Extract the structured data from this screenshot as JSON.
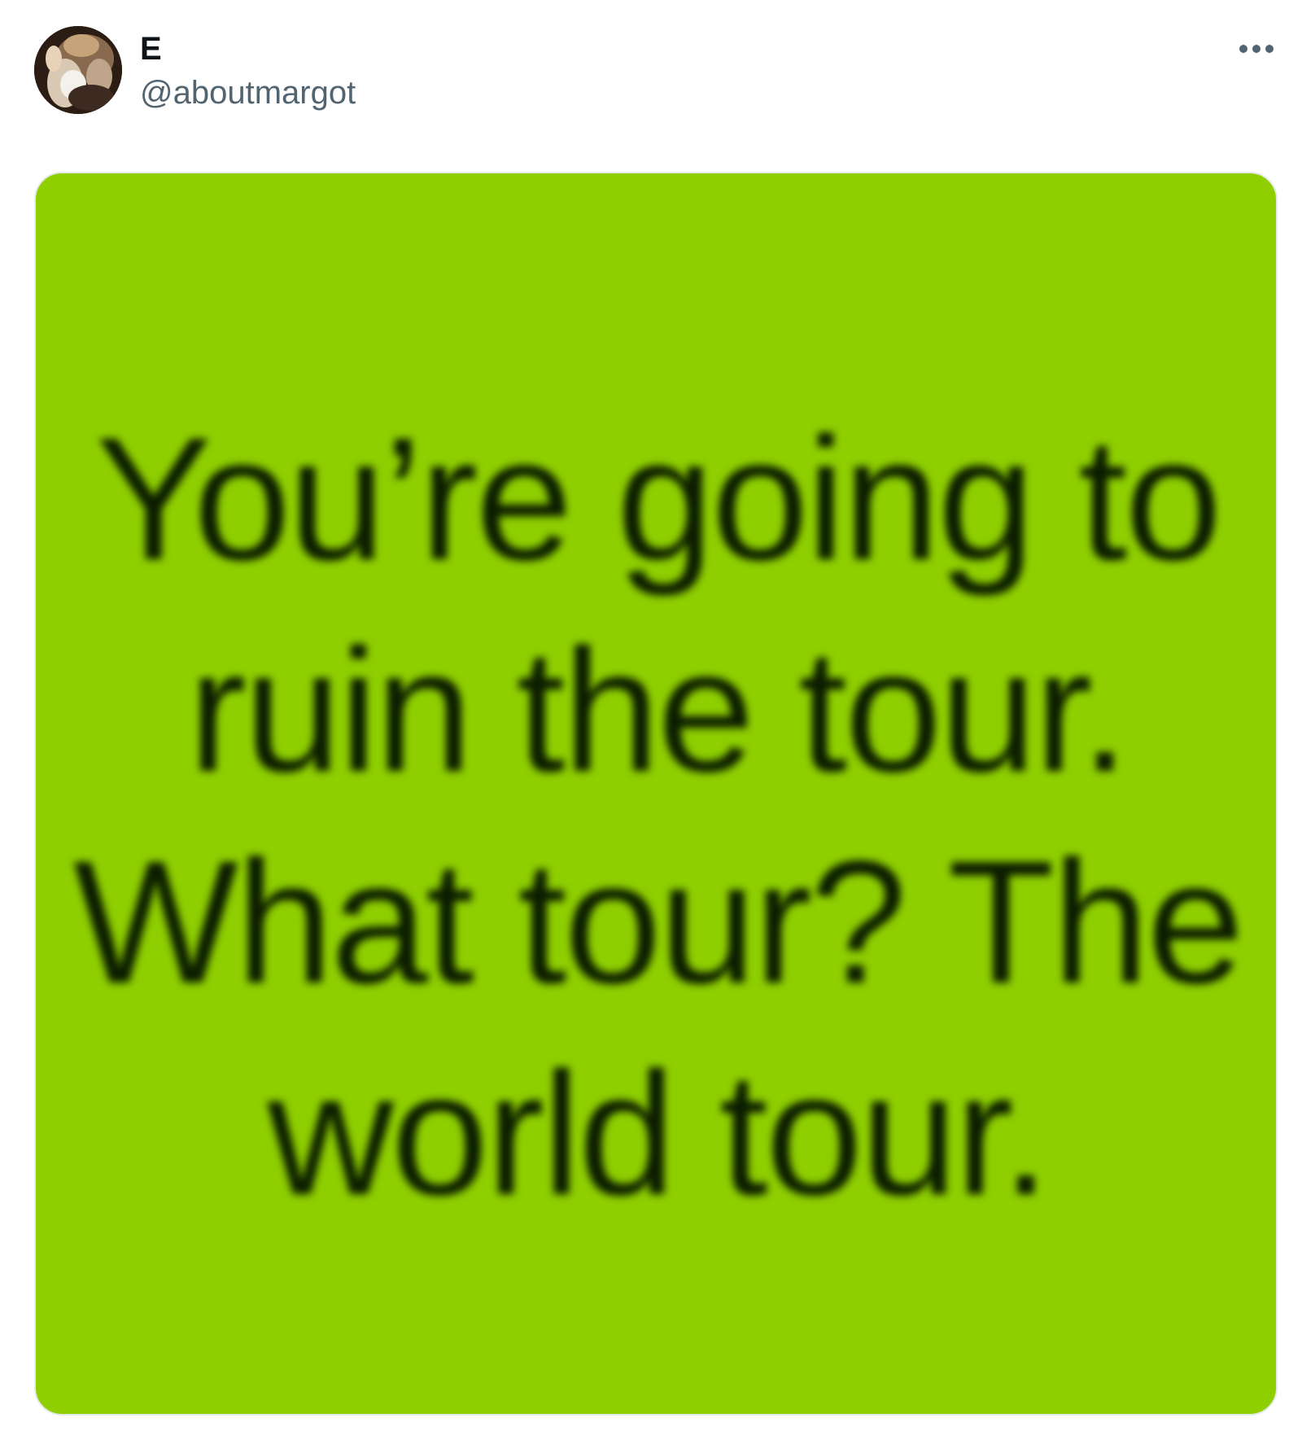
{
  "author": {
    "display_name": "E",
    "handle": "@aboutmargot",
    "avatar_icon": "profile-photo"
  },
  "header": {
    "more_icon": "ellipsis-icon"
  },
  "media": {
    "background_color": "#8fcf00",
    "text": "You’re going to\nruin the tour.\nWhat tour? The\nworld tour."
  }
}
